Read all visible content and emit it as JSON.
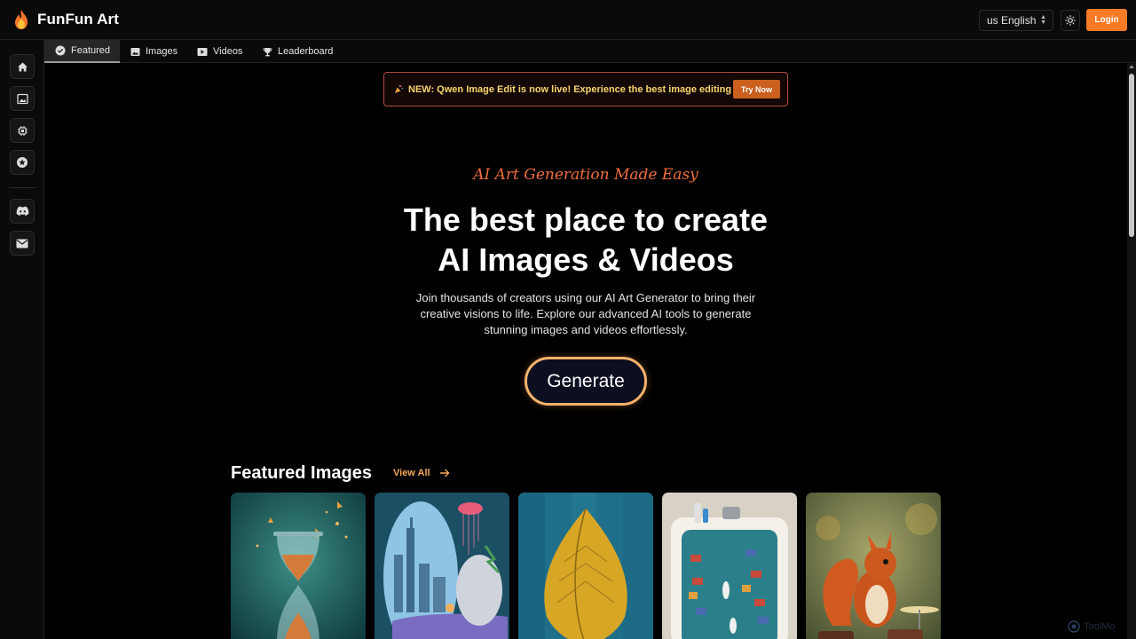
{
  "app": {
    "name": "FunFun Art"
  },
  "header": {
    "language": "us English",
    "login_label": "Login"
  },
  "tabs": [
    {
      "label": "Featured",
      "icon": "badge-check-icon",
      "active": true
    },
    {
      "label": "Images",
      "icon": "image-icon",
      "active": false
    },
    {
      "label": "Videos",
      "icon": "video-icon",
      "active": false
    },
    {
      "label": "Leaderboard",
      "icon": "trophy-icon",
      "active": false
    }
  ],
  "sidebar": {
    "items": [
      {
        "name": "home",
        "icon": "home-icon"
      },
      {
        "name": "images",
        "icon": "image-icon"
      },
      {
        "name": "models",
        "icon": "chip-icon"
      },
      {
        "name": "featured",
        "icon": "star-badge-icon"
      },
      {
        "name": "discord",
        "icon": "discord-icon"
      },
      {
        "name": "mail",
        "icon": "mail-icon"
      }
    ]
  },
  "banner": {
    "text": "NEW: Qwen Image Edit is now live! Experience the best image editing now!",
    "button_label": "Try Now"
  },
  "hero": {
    "tagline": "AI Art Generation Made Easy",
    "title_line1": "The best place to create",
    "title_line2": "AI Images & Videos",
    "description": "Join thousands of creators using our AI Art Generator to bring their creative visions to life. Explore our advanced AI tools to generate stunning images and videos effortlessly.",
    "cta_label": "Generate"
  },
  "featured": {
    "title": "Featured Images",
    "view_all_label": "View All"
  },
  "colors": {
    "accent": "#f77a24",
    "banner_border": "#b14a3a",
    "banner_text": "#f7d66e",
    "tagline": "#ef6e3f",
    "cta_border": "#f7b26c"
  },
  "watermark": "ToolMo"
}
